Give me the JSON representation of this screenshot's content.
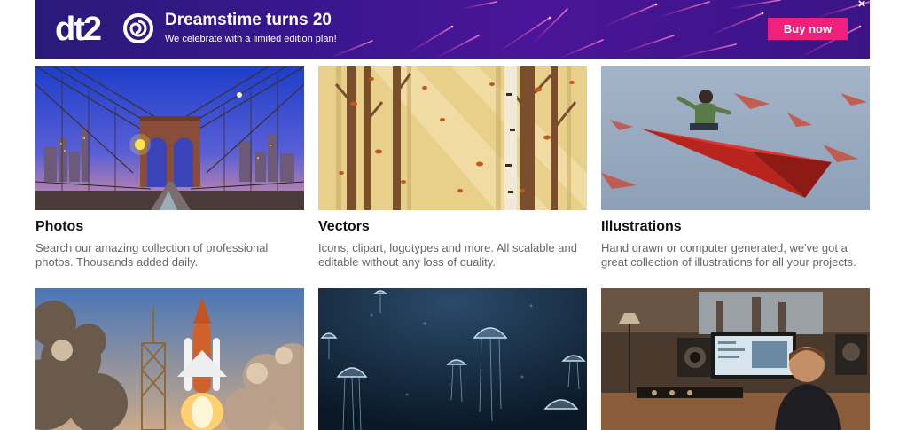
{
  "banner": {
    "logo_text": "dt20",
    "title": "Dreamstime turns 20",
    "subtitle": "We celebrate with a limited edition plan!",
    "cta_label": "Buy now",
    "close_label": "×",
    "colors": {
      "background": "#3a1690",
      "cta": "#f0207c"
    }
  },
  "categories": [
    {
      "title": "Photos",
      "description_line1": "Search our amazing collection of professional",
      "description_line2": "photos. Thousands added daily."
    },
    {
      "title": "Vectors",
      "description_line1": "Icons, clipart, logotypes and more. All scalable and",
      "description_line2": "editable without any loss of quality."
    },
    {
      "title": "Illustrations",
      "description_line1": "Hand drawn or computer generated, we've got a",
      "description_line2": "great collection of illustrations for all your projects."
    }
  ]
}
